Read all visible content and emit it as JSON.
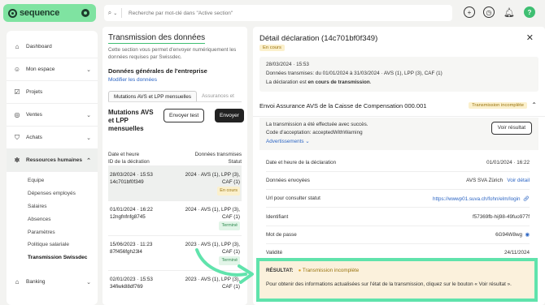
{
  "logo": {
    "text": "sequence"
  },
  "search": {
    "placeholder": "Recherche par mot-clé dans \"Active section\""
  },
  "sidebar": {
    "items": [
      {
        "label": "Dashboard",
        "icon": "home-icon"
      },
      {
        "label": "Mon espace",
        "icon": "user-icon",
        "chevron": true
      },
      {
        "label": "Projets",
        "icon": "check-square-icon"
      },
      {
        "label": "Ventes",
        "icon": "coins-icon",
        "chevron": true
      },
      {
        "label": "Achats",
        "icon": "cart-icon",
        "chevron": true
      },
      {
        "label": "Ressources humaines",
        "icon": "hr-icon",
        "chevron": true
      }
    ],
    "subitems": [
      "Equipe",
      "Dépenses employés",
      "Salaires",
      "Absences",
      "Paramètres",
      "Politique salariale",
      "Transmission Swissdec"
    ],
    "bottom": [
      {
        "label": "Banking",
        "icon": "bank-icon"
      }
    ]
  },
  "mid": {
    "title": "Transmission des données",
    "desc": "Cette section vous permet d'envoyer numériquement les données requises par Swissdec.",
    "company_title": "Données générales de l'entreprise",
    "modify_link": "Modifier les données",
    "tabs": [
      "Mutations AVS et LPP mensuelles",
      "Assurances et"
    ],
    "mut_title": "Mutations AVS et LPP mensuelles",
    "send_test": "Envoyer test",
    "send": "Envoyer",
    "col_left": [
      "Date et heure",
      "ID de la déclration"
    ],
    "col_right": [
      "Données transmises",
      "Statut"
    ],
    "rows": [
      {
        "date": "28/03/2024 · 15:53",
        "id": "14c701bf0f349",
        "data": "2024 · AVS (1), LPP (3), CAF (1)",
        "status": "En cours",
        "status_type": "y"
      },
      {
        "date": "01/01/2024 · 16:22",
        "id": "12ngfnfnfg8745",
        "data": "2024 · AVS (1), LPP (3), CAF (1)",
        "status": "Terminé",
        "status_type": "g"
      },
      {
        "date": "15/06/2023 · 11:23",
        "id": "87f456fgh23l4",
        "data": "2023 · AVS (1), LPP (3), CAF (1)",
        "status": "Terminé",
        "status_type": "g"
      },
      {
        "date": "02/01/2023 · 15:53",
        "id": "34fiwk88df769",
        "data": "2023 · AVS (1), LPP (3), CAF (1)",
        "status": "",
        "status_type": ""
      }
    ]
  },
  "right": {
    "title": "Détail déclaration (14c701bf0f349)",
    "badge": "En cours",
    "info_time": "28/03/2024 · 15:53",
    "info_data": "Données transmises: du 01/01/2024 à 31/03/2024 · AVS (1), LPP (3), CAF (1)",
    "info_status_prefix": "La déclaration est ",
    "info_status_bold": "en cours de transmission",
    "section_title": "Envoi Assurance AVS de la Caisse de Compensation 000.001",
    "section_badge": "Transmission incomplète",
    "succ_line1": "La transmission a été effectuée avec succès.",
    "succ_line2": "Code d'acceptation: acceptedWithWarning",
    "advert": "Advertissements",
    "view_result": "Voir résultat",
    "fields": [
      {
        "label": "Date et heure de la déclaration",
        "value": "01/01/2024 · 16:22"
      },
      {
        "label": "Données envoyées",
        "value": "AVS SVA Zürich",
        "link": "Voir détail"
      },
      {
        "label": "Url pour consulter statut",
        "value": "https://wwwp01.suva.ch/fohn/elm/login"
      },
      {
        "label": "Identifiant",
        "value": "f57369fb-hij98-49fuo977f"
      },
      {
        "label": "Mot de passe",
        "value": "6G94W8wg"
      },
      {
        "label": "Validité",
        "value": "24/11/2024"
      }
    ]
  },
  "result": {
    "label": "RÉSULTAT:",
    "status": "Transmission incomplète",
    "text": "Pour obtenir des informations actualisées sur l'état de la transmission, cliquez sur le bouton « Voir résultat »."
  },
  "colors": {
    "accent": "#3fbf72",
    "highlight_border": "#60e3ac",
    "warning_bg": "#fbf0cc",
    "link": "#2d66c4"
  }
}
